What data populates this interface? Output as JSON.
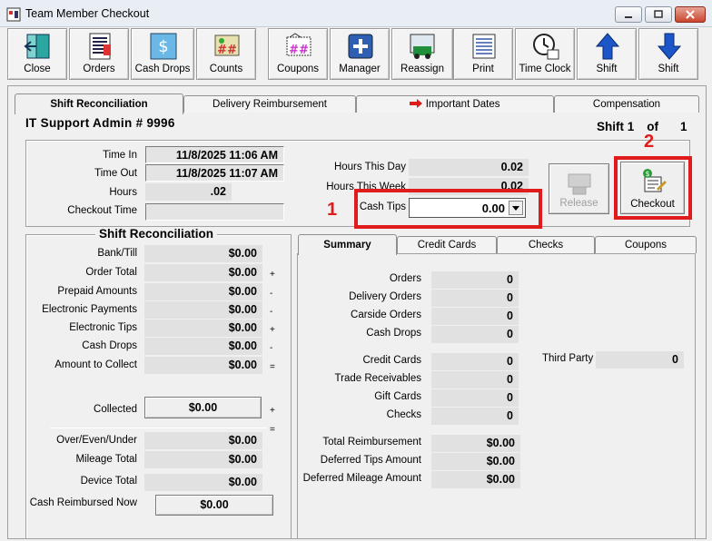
{
  "window": {
    "title": "Team Member Checkout"
  },
  "toolbar": [
    {
      "label": "Close",
      "icon": "door-exit-icon"
    },
    {
      "label": "Orders",
      "icon": "orders-list-icon"
    },
    {
      "label": "Cash Drops",
      "icon": "cash-drops-icon"
    },
    {
      "label": "Counts",
      "icon": "counts-icon"
    },
    {
      "label": "Coupons",
      "icon": "coupons-icon"
    },
    {
      "label": "Manager",
      "icon": "manager-plus-icon"
    },
    {
      "label": "Reassign",
      "icon": "reassign-icon"
    },
    {
      "label": "Print",
      "icon": "print-icon"
    },
    {
      "label": "Time Clock",
      "icon": "time-clock-icon"
    },
    {
      "label": "Shift",
      "icon": "arrow-up-icon"
    },
    {
      "label": "Shift",
      "icon": "arrow-down-icon"
    }
  ],
  "tabs": [
    "Shift Reconciliation",
    "Delivery Reimbursement",
    "Important Dates",
    "Compensation"
  ],
  "header": {
    "employee": "IT Support  Admin # 9996",
    "shift_label": "Shift 1",
    "of_label": "of",
    "shift_total": "1"
  },
  "times": {
    "time_in_label": "Time In",
    "time_in": "11/8/2025 11:06 AM",
    "time_out_label": "Time Out",
    "time_out": "11/8/2025 11:07 AM",
    "hours_label": "Hours",
    "hours": ".02",
    "checkout_label": "Checkout Time",
    "checkout": ""
  },
  "hours": {
    "today_label": "Hours This Day",
    "today": "0.02",
    "week_label": "Hours This Week",
    "week": "0.02",
    "tips_label": "Cash Tips",
    "tips": "0.00"
  },
  "buttons": {
    "release": "Release",
    "checkout": "Checkout"
  },
  "annotations": {
    "one": "1",
    "two": "2"
  },
  "reconciliation": {
    "title": "Shift Reconciliation",
    "rows": [
      {
        "label": "Bank/Till",
        "value": "$0.00",
        "op": ""
      },
      {
        "label": "Order Total",
        "value": "$0.00",
        "op": "+"
      },
      {
        "label": "Prepaid Amounts",
        "value": "$0.00",
        "op": "-"
      },
      {
        "label": "Electronic Payments",
        "value": "$0.00",
        "op": "-"
      },
      {
        "label": "Electronic Tips",
        "value": "$0.00",
        "op": "+"
      },
      {
        "label": "Cash Drops",
        "value": "$0.00",
        "op": "-"
      },
      {
        "label": "Amount to Collect",
        "value": "$0.00",
        "op": "="
      }
    ],
    "collected_label": "Collected",
    "collected": "$0.00",
    "collected_op": "+",
    "line_op": "=",
    "over_label": "Over/Even/Under",
    "over": "$0.00",
    "mileage_label": "Mileage Total",
    "mileage": "$0.00",
    "device_label": "Device Total",
    "device": "$0.00",
    "reimb_label": "Cash Reimbursed Now",
    "reimb": "$0.00"
  },
  "summary_tabs": [
    "Summary",
    "Credit Cards",
    "Checks",
    "Coupons"
  ],
  "summary": {
    "orders": [
      {
        "label": "Orders",
        "value": "0"
      },
      {
        "label": "Delivery Orders",
        "value": "0"
      },
      {
        "label": "Carside Orders",
        "value": "0"
      },
      {
        "label": "Cash Drops",
        "value": "0"
      }
    ],
    "payments": [
      {
        "label": "Credit Cards",
        "value": "0"
      },
      {
        "label": "Trade Receivables",
        "value": "0"
      },
      {
        "label": "Gift Cards",
        "value": "0"
      },
      {
        "label": "Checks",
        "value": "0"
      }
    ],
    "third_party_label": "Third Party",
    "third_party": "0",
    "totals": [
      {
        "label": "Total Reimbursement",
        "value": "$0.00"
      },
      {
        "label": "Deferred Tips Amount",
        "value": "$0.00"
      },
      {
        "label": "Deferred Mileage Amount",
        "value": "$0.00"
      }
    ]
  },
  "colors": {
    "annotation": "#e01b1b",
    "titlebar": "#e9eef5"
  }
}
